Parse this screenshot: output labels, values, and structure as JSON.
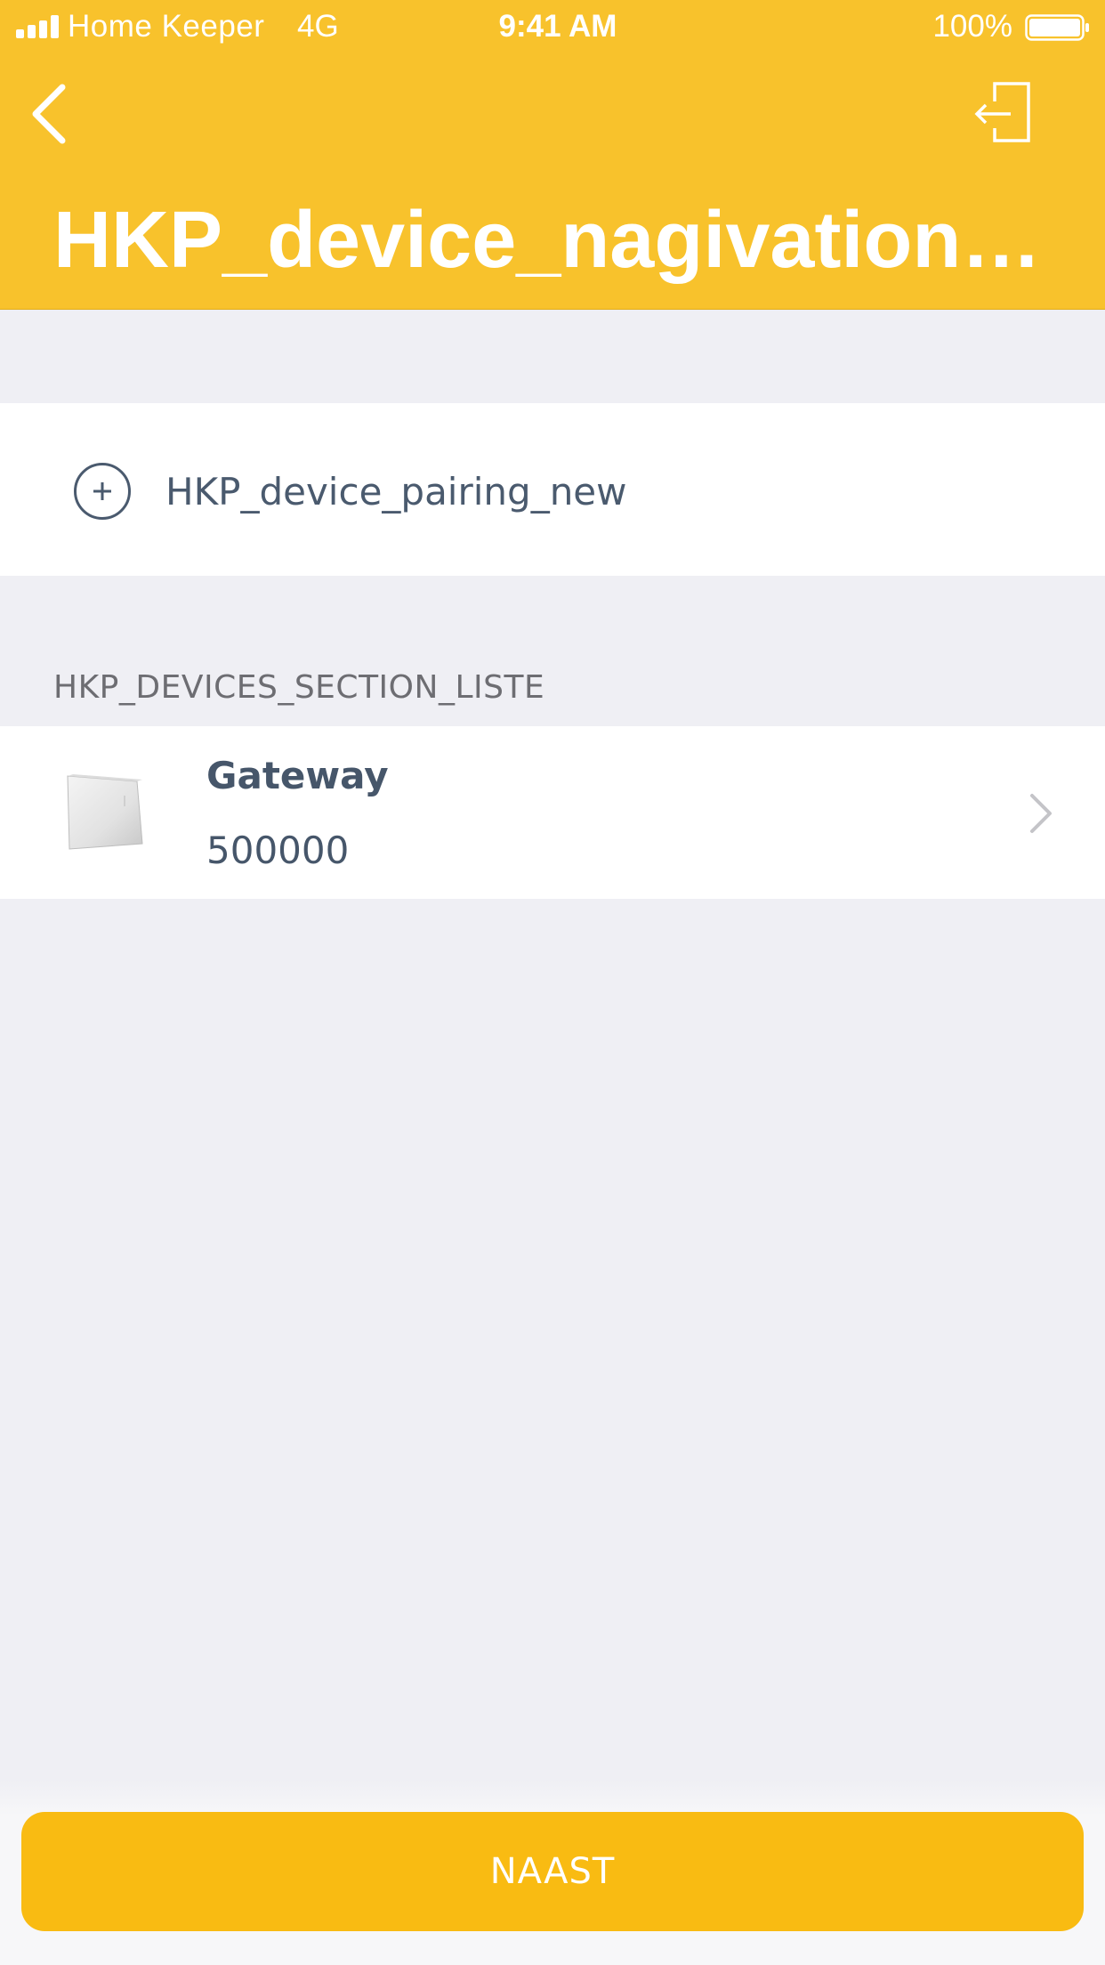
{
  "status_bar": {
    "carrier": "Home Keeper",
    "network": "4G",
    "time": "9:41 AM",
    "battery": "100%",
    "signal_icon": "signal-bars-icon",
    "battery_icon": "battery-full-icon"
  },
  "header": {
    "title": "HKP_device_nagivation_ti...",
    "back_icon": "chevron-left-icon",
    "logout_icon": "logout-icon"
  },
  "add_device": {
    "label": "HKP_device_pairing_new",
    "icon": "plus-circle-icon"
  },
  "devices_section": {
    "title": "HKP_DEVICES_SECTION_LISTE",
    "items": [
      {
        "name": "Gateway",
        "serial": "500000",
        "image": "gateway-device-image",
        "chevron": "chevron-right-icon"
      }
    ]
  },
  "footer": {
    "next_label": "NAAST"
  },
  "colors": {
    "accent": "#f8c22c",
    "button": "#f9bb12",
    "background": "#efeff4",
    "text_primary": "#46566a",
    "section_text": "#6d6d72"
  }
}
